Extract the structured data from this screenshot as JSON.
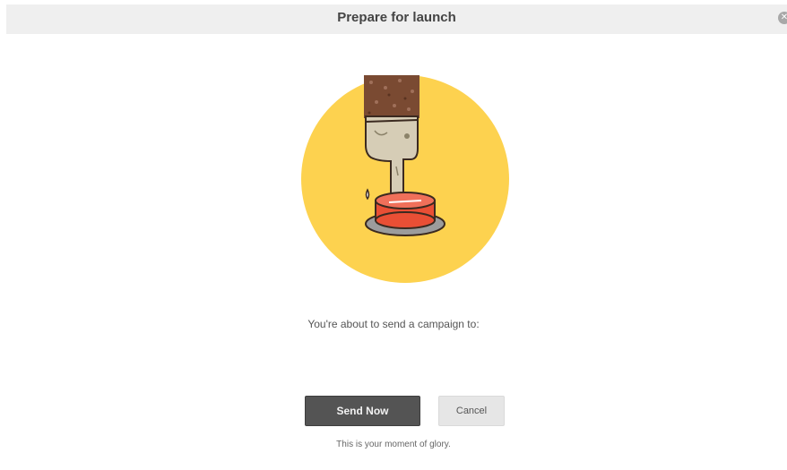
{
  "modal": {
    "title": "Prepare for launch",
    "close_icon": "close-icon",
    "illustration": "finger-pressing-red-button-illustration",
    "message": "You're about to send a campaign to:",
    "send_label": "Send Now",
    "cancel_label": "Cancel",
    "footer_note": "This is your moment of glory."
  },
  "colors": {
    "header_bg": "#efefef",
    "illustration_circle": "#fdd24f",
    "red_button": "#e94f35",
    "send_button_bg": "#545454",
    "cancel_button_bg": "#e6e6e6"
  }
}
